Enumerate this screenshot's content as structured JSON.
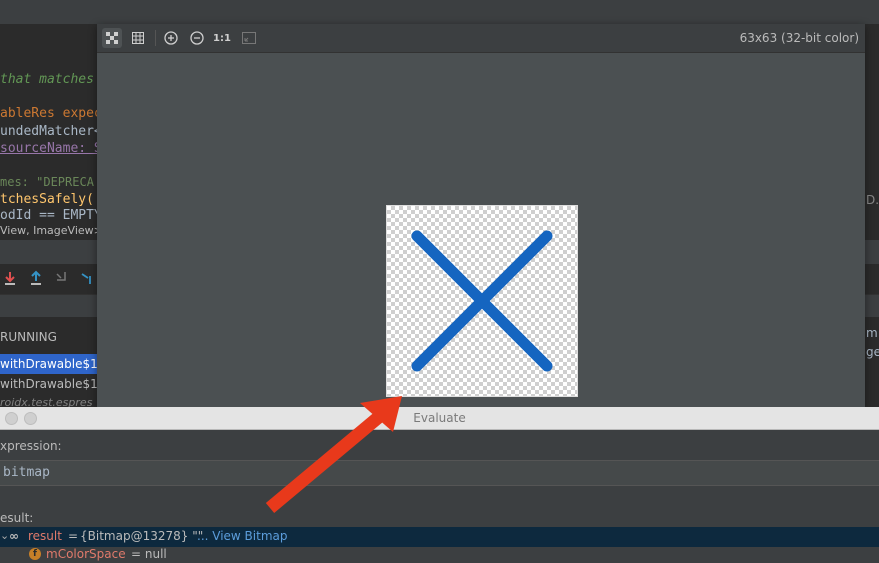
{
  "ide": {
    "code_lines": [
      {
        "text": "that matches",
        "color": "#629755",
        "italic": true
      },
      {
        "text": "ableRes expec",
        "color": "#cc7832"
      },
      {
        "text": "undedMatcher<",
        "color": "#a9b7c6"
      },
      {
        "text": "sourceName: S",
        "color": "#9876aa"
      },
      {
        "text": "mes: \"DEPRECA",
        "color": "#6a8759"
      },
      {
        "text": "tchesSafely(",
        "color": "#ffc66d"
      },
      {
        "text": "odId == EMPTY",
        "color": "#a9b7c6"
      },
      {
        "text": "View, ImageView>",
        "color": "#a9b7c6"
      }
    ],
    "run_panel": {
      "header": "RUNNING",
      "items": [
        "withDrawable$1",
        "withDrawable$1",
        "roidx.test.espres"
      ]
    },
    "right_fragments": [
      "D.",
      "m",
      "ge"
    ]
  },
  "viewer": {
    "dimensions": "63x63  (32-bit color)",
    "tools": [
      "chessboard-icon",
      "grid-icon",
      "zoom-in-icon",
      "zoom-out-icon",
      "actual-size-icon",
      "fit-icon"
    ],
    "actual_size_label": "1:1",
    "image_color": "#1565c0"
  },
  "evaluate": {
    "title": "Evaluate",
    "expression_label": "xpression:",
    "expression_value": "bitmap",
    "result_label": "esult:",
    "result": {
      "name": "result",
      "equals": "=",
      "value": "{Bitmap@13278} \"\"",
      "link": "... View Bitmap"
    },
    "field": {
      "badge": "f",
      "name": "mColorSpace",
      "value": "= null"
    }
  },
  "arrow_color": "#e8391b"
}
